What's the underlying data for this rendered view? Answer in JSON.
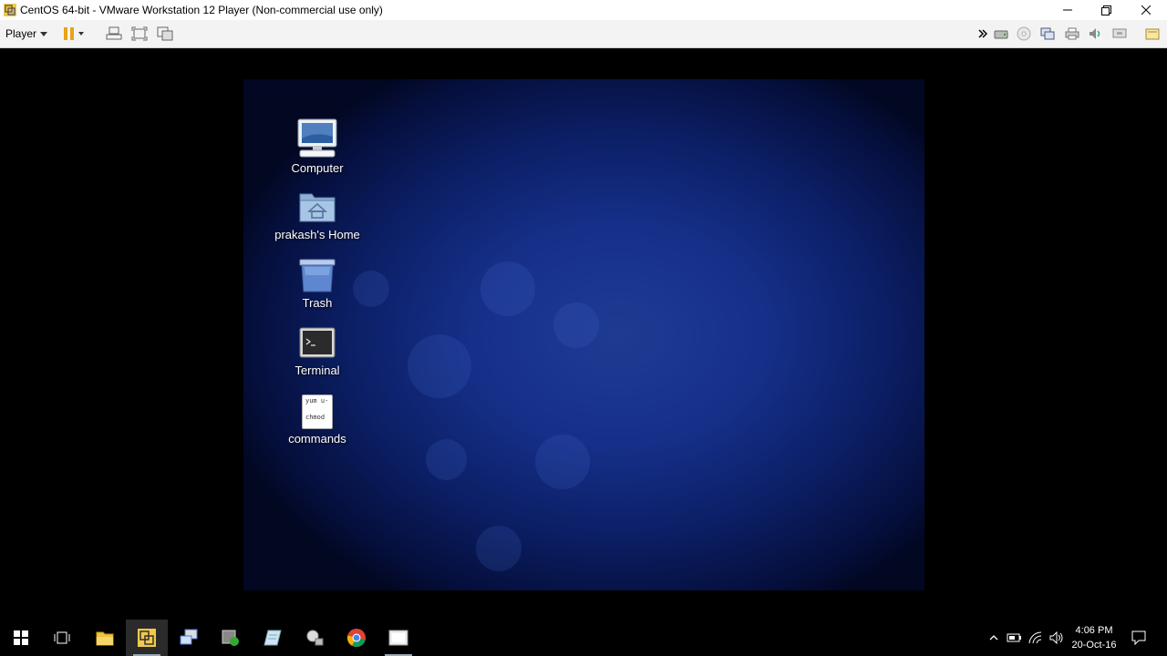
{
  "window": {
    "title": "CentOS 64-bit - VMware Workstation 12 Player (Non-commercial use only)"
  },
  "toolbar": {
    "player_label": "Player"
  },
  "desktop": {
    "icons": [
      {
        "label": "Computer"
      },
      {
        "label": "prakash's Home"
      },
      {
        "label": "Trash"
      },
      {
        "label": "Terminal"
      },
      {
        "label": "commands",
        "preview_line1": "yum u-",
        "preview_line2": "chmod"
      }
    ]
  },
  "taskbar": {
    "time": "4:06 PM",
    "date": "20-Oct-16"
  },
  "colors": {
    "desktop_center": "#1e3b92",
    "desktop_edge": "#020722",
    "toolbar_bg": "#f3f3f3"
  }
}
